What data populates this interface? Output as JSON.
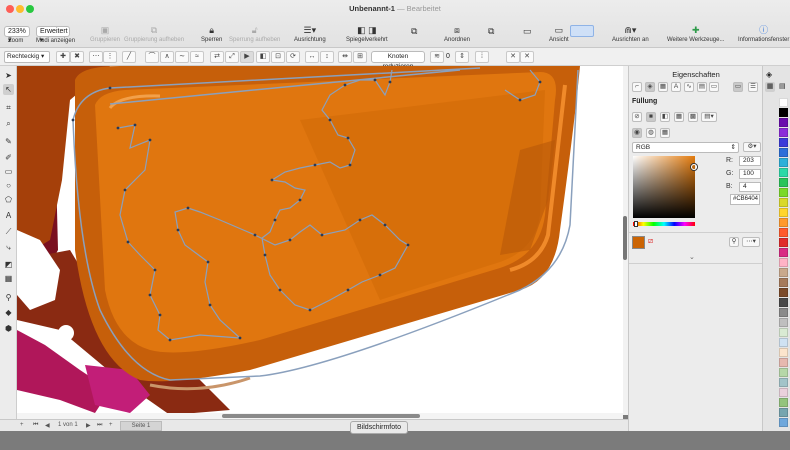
{
  "window": {
    "title": "Unbenannt-1",
    "title_sep": "—",
    "subtitle": "Bearbeitet"
  },
  "toolbar": {
    "zoom_value": "233%",
    "zoom_label": "Zoom",
    "mode_value": "Erweitert",
    "mode_label": "Modi anzeigen",
    "group": "Gruppieren",
    "ungroup": "Gruppierung aufheben",
    "lock": "Sperren",
    "unlock": "Sperrung aufheben",
    "align": "Ausrichtung",
    "mirror": "Spiegelverkehrt",
    "arrange": "Anordnen",
    "view": "Ansicht",
    "snap": "Ausrichten an",
    "more_tools": "Weitere Werkzeuge...",
    "info": "Informationsfenster"
  },
  "propbar": {
    "shape_select": "Rechteckig",
    "reduce_nodes": "Knoten reduzieren",
    "value": "0"
  },
  "pagenav": {
    "page_of": "1  von  1",
    "page_tab": "Seite 1"
  },
  "status": {
    "screenshot_label": "Bildschirmfoto"
  },
  "properties": {
    "title": "Eigenschaften",
    "fill_heading": "Füllung",
    "color_model": "RGB",
    "r_label": "R:",
    "r_value": "203",
    "g_label": "G:",
    "g_value": "100",
    "b_label": "B:",
    "b_value": "4",
    "hex": "#CB6404"
  },
  "colors": {
    "fill": "#CB6404",
    "accent": "#3b7de0"
  },
  "palette": [
    "#ffffff",
    "#000000",
    "#6a0dad",
    "#8b2bd9",
    "#3b3bd9",
    "#2b6fd9",
    "#2bb0d9",
    "#2bd9a7",
    "#29c45a",
    "#7ad929",
    "#d9d929",
    "#ffd52b",
    "#ff9a2b",
    "#ff5a2b",
    "#e02b2b",
    "#d92b84",
    "#ffb3c6",
    "#c9a98c",
    "#a67b5b",
    "#7b4b2a",
    "#4a4a4a",
    "#8a8a8a",
    "#bfbfbf",
    "#d9ead3",
    "#cfe2f3",
    "#fce5cd",
    "#e6b8af",
    "#b6d7a8",
    "#a2c4c9",
    "#ead1dc",
    "#93c47d",
    "#76a5af",
    "#6fa8dc"
  ]
}
